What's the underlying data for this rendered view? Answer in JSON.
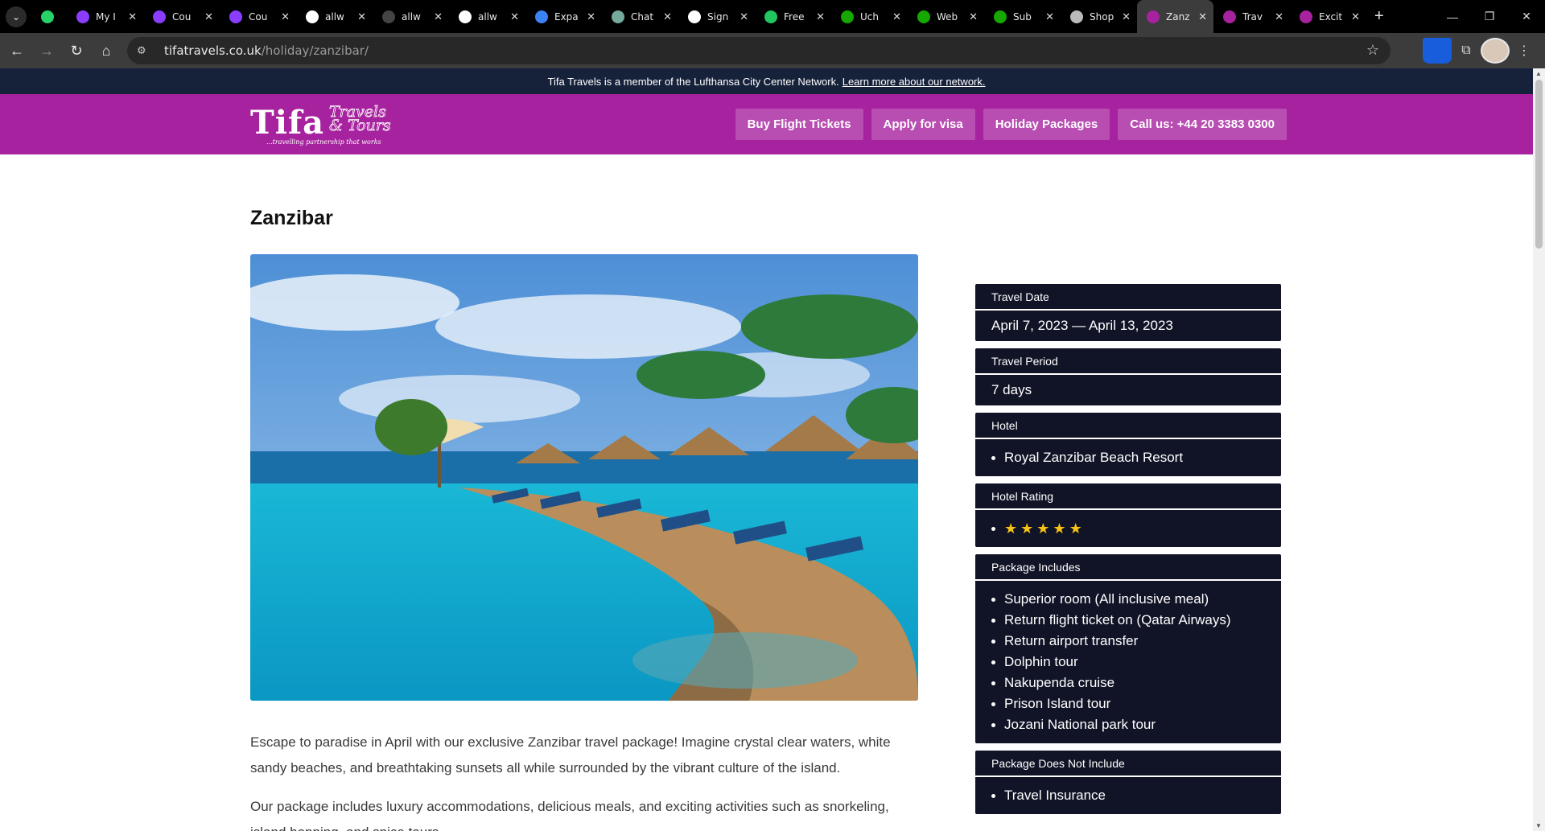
{
  "browser": {
    "tabs": [
      {
        "title": "",
        "icon": "whatsapp-icon",
        "color": "#25d366"
      },
      {
        "title": "My I",
        "icon": "tab-u-icon",
        "color": "#8b3dff"
      },
      {
        "title": "Cou",
        "icon": "tab-u-icon",
        "color": "#8b3dff"
      },
      {
        "title": "Cou",
        "icon": "tab-u-icon",
        "color": "#8b3dff"
      },
      {
        "title": "allw",
        "icon": "github-icon",
        "color": "#ffffff"
      },
      {
        "title": "allw",
        "icon": "circle-icon",
        "color": "#444444"
      },
      {
        "title": "allw",
        "icon": "github-icon",
        "color": "#ffffff"
      },
      {
        "title": "Expa",
        "icon": "plane-icon",
        "color": "#3b82f6"
      },
      {
        "title": "Chat",
        "icon": "chatgpt-icon",
        "color": "#74aa9c"
      },
      {
        "title": "Sign",
        "icon": "circle-icon",
        "color": "#ffffff"
      },
      {
        "title": "Free",
        "icon": "plus-icon",
        "color": "#22c55e"
      },
      {
        "title": "Uch",
        "icon": "upwork-icon",
        "color": "#14a800"
      },
      {
        "title": "Web",
        "icon": "upwork-icon",
        "color": "#14a800"
      },
      {
        "title": "Sub",
        "icon": "upwork-icon",
        "color": "#14a800"
      },
      {
        "title": "Shop",
        "icon": "arc-icon",
        "color": "#bbbbbb"
      },
      {
        "title": "Zanz",
        "icon": "tifa-icon",
        "color": "#a6229e"
      },
      {
        "title": "Trav",
        "icon": "tifa-t-icon",
        "color": "#a6229e"
      },
      {
        "title": "Excit",
        "icon": "tifa-t-icon",
        "color": "#a6229e"
      }
    ],
    "active_tab": 15,
    "url_host": "tifatravels.co.uk",
    "url_path": "/holiday/zanzibar/"
  },
  "topbar": {
    "text": "Tifa Travels is a member of the Lufthansa City Center Network.",
    "link": "Learn more about our network."
  },
  "header": {
    "logo_main": "Tifa",
    "logo_sub_1": "Travels",
    "logo_sub_2": "& Tours",
    "logo_tagline": "...travelling partnership that works",
    "menu": [
      "Buy Flight Tickets",
      "Apply for visa",
      "Holiday Packages",
      "Call us: +44 20 3383 0300"
    ]
  },
  "page": {
    "title": "Zanzibar",
    "description": [
      "Escape to paradise in April with our exclusive Zanzibar travel package! Imagine crystal clear waters, white sandy beaches, and breathtaking sunsets all while surrounded by the vibrant culture of the island.",
      "Our package includes luxury accommodations, delicious meals, and exciting activities such as snorkeling, island hopping, and spice tours."
    ]
  },
  "details": {
    "travel_date_label": "Travel Date",
    "travel_date": "April 7, 2023 — April 13, 2023",
    "travel_period_label": "Travel Period",
    "travel_period": "7 days",
    "hotel_label": "Hotel",
    "hotel": "Royal Zanzibar Beach Resort",
    "rating_label": "Hotel Rating",
    "rating_stars": 5,
    "includes_label": "Package Includes",
    "includes": [
      "Superior room (All inclusive meal)",
      "Return flight ticket on (Qatar Airways)",
      "Return airport transfer",
      "Dolphin tour",
      "Nakupenda cruise",
      "Prison Island tour",
      "Jozani National park tour"
    ],
    "excludes_label": "Package Does Not Include",
    "excludes": [
      "Travel Insurance"
    ]
  },
  "colors": {
    "brand": "#a6229e",
    "dark": "#111427",
    "star": "#f6c315"
  }
}
